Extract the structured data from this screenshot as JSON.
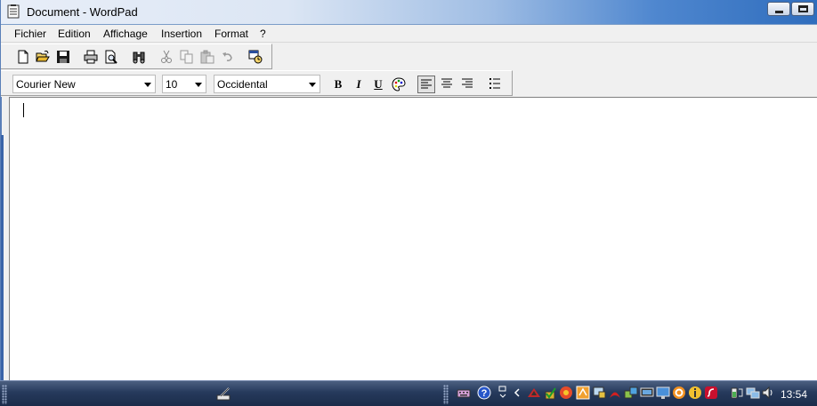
{
  "window": {
    "title": "Document - WordPad"
  },
  "menu": {
    "items": [
      "Fichier",
      "Edition",
      "Affichage",
      "Insertion",
      "Format",
      "?"
    ]
  },
  "toolbar": {
    "buttons": [
      "new-icon",
      "open-icon",
      "save-icon",
      "print-icon",
      "print-preview-icon",
      "find-icon",
      "cut-icon",
      "copy-icon",
      "paste-icon",
      "undo-icon",
      "insert-date-time-icon"
    ]
  },
  "format_bar": {
    "font": "Courier New",
    "size": "10",
    "script": "Occidental",
    "bold_label": "B",
    "italic_label": "I",
    "underline_label": "U"
  },
  "taskbar": {
    "clock": "13:54"
  },
  "colors": {
    "titlebar_end": "#2f6dbd",
    "taskbar": "#263a5c",
    "editor_bg": "#ffffff"
  }
}
